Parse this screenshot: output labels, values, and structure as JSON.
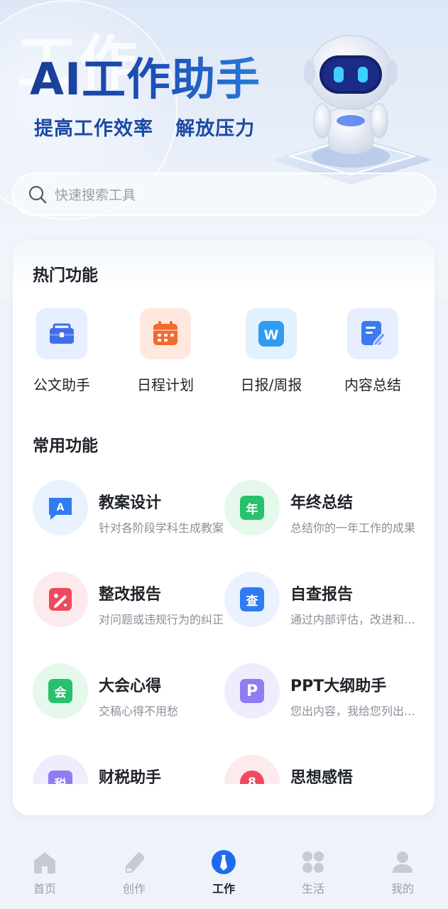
{
  "hero": {
    "watermark": "工作",
    "title": "AI工作助手",
    "subtitle": "提高工作效率   解放压力"
  },
  "search": {
    "placeholder": "快速搜索工具"
  },
  "hot": {
    "title": "热门功能",
    "items": [
      {
        "label": "公文助手",
        "icon": "briefcase-icon",
        "color": "#3f6fe6",
        "bg": "#e6eeff"
      },
      {
        "label": "日程计划",
        "icon": "calendar-icon",
        "color": "#f26a2e",
        "bg": "#ffe9df"
      },
      {
        "label": "日报/周报",
        "icon": "word-doc-icon",
        "color": "#2f9cf0",
        "bg": "#e1f1fd"
      },
      {
        "label": "内容总结",
        "icon": "edit-note-icon",
        "color": "#3b7af0",
        "bg": "#e6eeff"
      }
    ]
  },
  "common": {
    "title": "常用功能",
    "items": [
      {
        "title": "教案设计",
        "desc": "针对各阶段学科生成教案",
        "glyph": "A",
        "icon": "lesson-plan-icon",
        "color": "#2f7bf2",
        "bg": "#eaf2ff"
      },
      {
        "title": "年终总结",
        "desc": "总结你的一年工作的成果",
        "glyph": "年",
        "icon": "year-end-icon",
        "color": "#27c26a",
        "bg": "#e4f8ec"
      },
      {
        "title": "整改报告",
        "desc": "对问题或违规行为的纠正",
        "glyph": "✎",
        "icon": "rectify-report-icon",
        "color": "#ee4a5d",
        "bg": "#fdeaec"
      },
      {
        "title": "自查报告",
        "desc": "通过内部评估，改进和提升",
        "glyph": "查",
        "icon": "self-check-icon",
        "color": "#2f7bf2",
        "bg": "#eaf2ff"
      },
      {
        "title": "大会心得",
        "desc": "交稿心得不用愁",
        "glyph": "会",
        "icon": "meeting-notes-icon",
        "color": "#27c26a",
        "bg": "#e4f8ec"
      },
      {
        "title": "PPT大纲助手",
        "desc": "您出内容，我给您列出大纲",
        "glyph": "P",
        "icon": "ppt-outline-icon",
        "color": "#8e7cf0",
        "bg": "#efecfd"
      },
      {
        "title": "财税助手",
        "desc": "",
        "glyph": "税",
        "icon": "tax-icon",
        "color": "#8e7cf0",
        "bg": "#efecfd"
      },
      {
        "title": "思想感悟",
        "desc": "",
        "glyph": "8",
        "icon": "thoughts-icon",
        "color": "#ee4a5d",
        "bg": "#fdeaec"
      }
    ]
  },
  "tabs": [
    {
      "label": "首页",
      "icon": "home-icon",
      "active": false
    },
    {
      "label": "创作",
      "icon": "pencil-icon",
      "active": false
    },
    {
      "label": "工作",
      "icon": "tie-icon",
      "active": true
    },
    {
      "label": "生活",
      "icon": "grid-icon",
      "active": false
    },
    {
      "label": "我的",
      "icon": "user-icon",
      "active": false
    }
  ],
  "colors": {
    "accent": "#1d6cf0",
    "inactive": "#c5cad3"
  }
}
